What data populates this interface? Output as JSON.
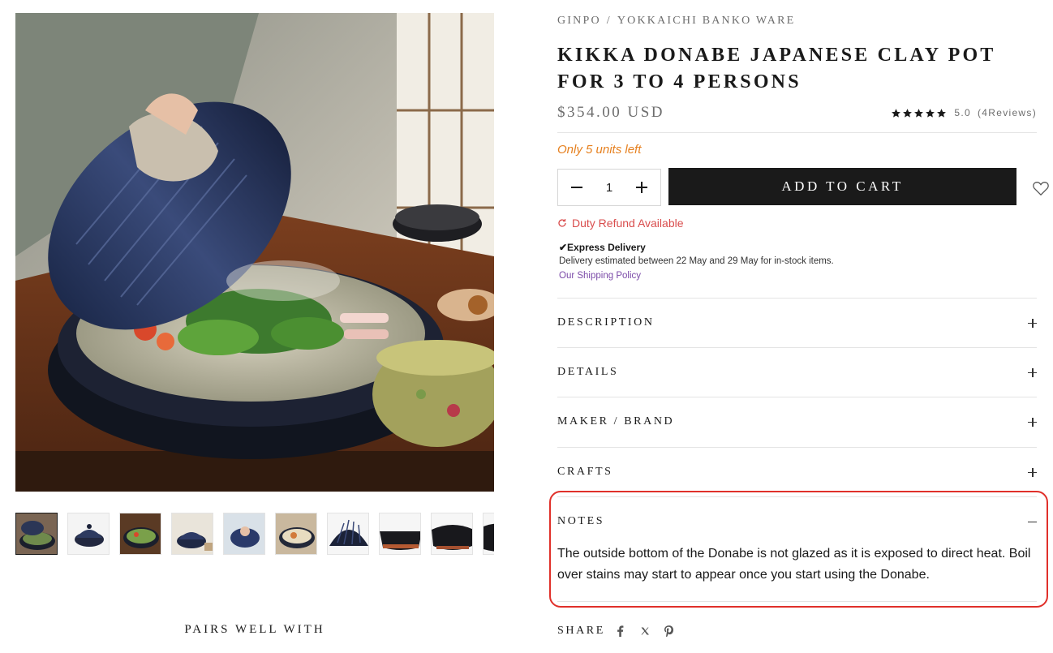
{
  "breadcrumb": {
    "brand": "GINPO",
    "separator": "/",
    "collection": "YOKKAICHI BANKO WARE"
  },
  "product": {
    "title": "KIKKA DONABE JAPANESE CLAY POT FOR 3 TO 4 PERSONS",
    "price": "$354.00 USD",
    "rating_value": "5.0",
    "reviews": "(4Reviews)",
    "stars": 5,
    "stock_note": "Only 5 units left",
    "quantity": "1",
    "add_to_cart": "ADD TO CART"
  },
  "shipping": {
    "duty": "Duty Refund Available",
    "express": "✔Express Delivery",
    "estimate": "Delivery estimated between 22 May and 29 May for in-stock items.",
    "policy_link": "Our Shipping Policy"
  },
  "accordion": [
    {
      "label": "DESCRIPTION",
      "open": false
    },
    {
      "label": "DETAILS",
      "open": false
    },
    {
      "label": "MAKER / BRAND",
      "open": false
    },
    {
      "label": "CRAFTS",
      "open": false
    },
    {
      "label": "NOTES",
      "open": true
    }
  ],
  "notes_text": "The outside bottom of the Donabe is not glazed as it is exposed to direct heat. Boil over stains may start to appear once you start using the Donabe.",
  "share": {
    "label": "SHARE",
    "icons": [
      "facebook-icon",
      "x-icon",
      "pinterest-icon"
    ]
  },
  "pairs_heading": "PAIRS WELL WITH",
  "thumbnails_count": 10,
  "colors": {
    "accent": "#1a1a1a",
    "stock": "#e6801f",
    "duty": "#d94d4d",
    "link": "#7b4aa8",
    "highlight": "#e0302a"
  }
}
